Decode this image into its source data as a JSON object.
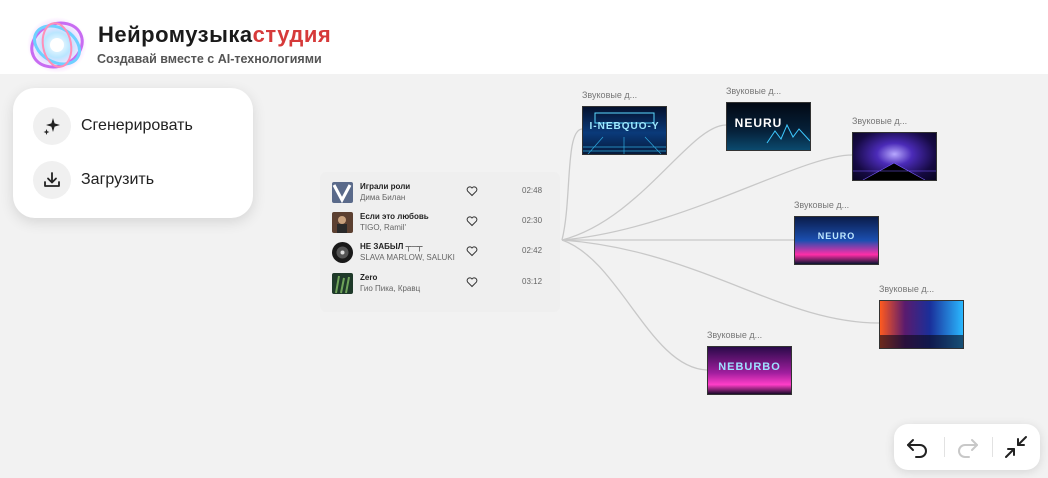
{
  "brand": {
    "title_main": "Нейромузыка",
    "title_accent": "студия",
    "subtitle": "Создавай вместе с AI-технологиями"
  },
  "actions": [
    {
      "label": "Сгенерировать",
      "icon": "sparkle-icon"
    },
    {
      "label": "Загрузить",
      "icon": "download-icon"
    }
  ],
  "tracks": [
    {
      "title": "Играли роли",
      "artist": "Дима Билан",
      "duration": "02:48"
    },
    {
      "title": "Если это любовь",
      "artist": "TIGO, Ramil'",
      "duration": "02:30"
    },
    {
      "title": "НЕ ЗАБЫЛ ┬─┬",
      "artist": "SLAVA MARLOW, SALUKI",
      "duration": "02:42"
    },
    {
      "title": "Zero",
      "artist": "Гио Пика, Кравц",
      "duration": "03:12"
    }
  ],
  "nodes": [
    {
      "caption": "Звуковые д...",
      "thumb_text": "I-NEBQUO-Y"
    },
    {
      "caption": "Звуковые д...",
      "thumb_text": "NEURU"
    },
    {
      "caption": "Звуковые д...",
      "thumb_text": ""
    },
    {
      "caption": "Звуковые д...",
      "thumb_text": "NEURO"
    },
    {
      "caption": "Звуковые д...",
      "thumb_text": ""
    },
    {
      "caption": "Звуковые д...",
      "thumb_text": "NEBURBO"
    }
  ],
  "colors": {
    "accent": "#d63a3a",
    "link": "#c8c8c8"
  },
  "toolbar": {
    "undo_icon": "undo-icon",
    "redo_icon": "redo-icon",
    "collapse_icon": "collapse-icon"
  }
}
